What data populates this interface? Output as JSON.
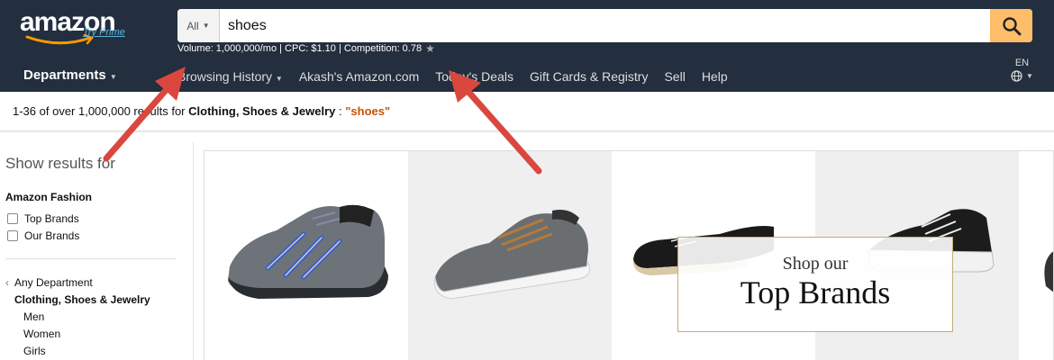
{
  "header": {
    "logo_text": "amazon",
    "try_prime": "Try Prime",
    "search": {
      "category": "All",
      "query": "shoes"
    },
    "keyword_stats": "Volume: 1,000,000/mo | CPC: $1.10 | Competition: 0.78",
    "departments_label": "Departments",
    "nav_links": [
      "Browsing History",
      "Akash's Amazon.com",
      "Today's Deals",
      "Gift Cards & Registry",
      "Sell",
      "Help"
    ],
    "language": "EN"
  },
  "results": {
    "count_text": "1-36 of over 1,000,000 results for ",
    "category": "Clothing, Shoes & Jewelry",
    "separator": " : ",
    "query": "\"shoes\""
  },
  "sidebar": {
    "heading": "Show results for",
    "section": "Amazon Fashion",
    "filters": [
      "Top Brands",
      "Our Brands"
    ],
    "any_department": "Any Department",
    "current_category": "Clothing, Shoes & Jewelry",
    "subcategories": [
      "Men",
      "Women",
      "Girls"
    ]
  },
  "banner": {
    "line1": "Shop our",
    "line2": "Top Brands"
  },
  "colors": {
    "header_bg": "#232f3e",
    "search_button": "#febd69",
    "query_accent": "#c45500",
    "annotation_arrow": "#d9473f"
  }
}
